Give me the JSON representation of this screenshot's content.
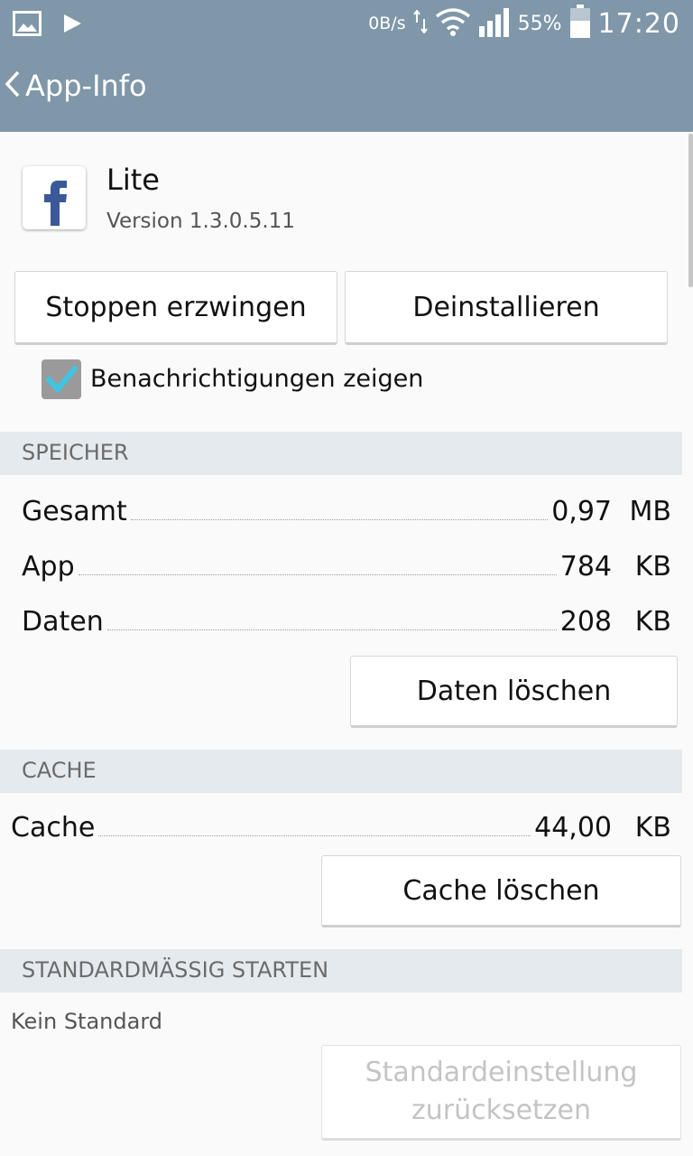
{
  "status_bar": {
    "net_speed": "0B/s",
    "battery_percent": "55%",
    "time": "17:20",
    "icons": [
      "gallery-icon",
      "play-icon",
      "data-transfer-icon",
      "wifi-icon",
      "signal-icon",
      "battery-icon"
    ]
  },
  "header": {
    "title": "App-Info",
    "back_icon": "chevron-left-icon"
  },
  "app": {
    "name": "Lite",
    "version": "Version 1.3.0.5.11",
    "icon": "facebook-lite-icon"
  },
  "actions": {
    "force_stop": "Stoppen erzwingen",
    "uninstall": "Deinstallieren"
  },
  "notifications": {
    "label": "Benachrichtigungen zeigen",
    "checked": true
  },
  "storage": {
    "header": "SPEICHER",
    "rows": [
      {
        "label": "Gesamt",
        "value": "0,97",
        "unit": "MB"
      },
      {
        "label": "App",
        "value": "784",
        "unit": "KB"
      },
      {
        "label": "Daten",
        "value": "208",
        "unit": "KB"
      }
    ],
    "clear_button": "Daten löschen"
  },
  "cache": {
    "header": "CACHE",
    "row": {
      "label": "Cache",
      "value": "44,00",
      "unit": "KB"
    },
    "clear_button": "Cache löschen"
  },
  "defaults": {
    "header": "STANDARDMÄSSIG STARTEN",
    "status": "Kein Standard",
    "reset_line1": "Standardeinstellung",
    "reset_line2": "zurücksetzen"
  },
  "colors": {
    "action_bar": "#7f97a8",
    "section_bg": "#e5eaee",
    "check_accent": "#3fc6e6"
  }
}
